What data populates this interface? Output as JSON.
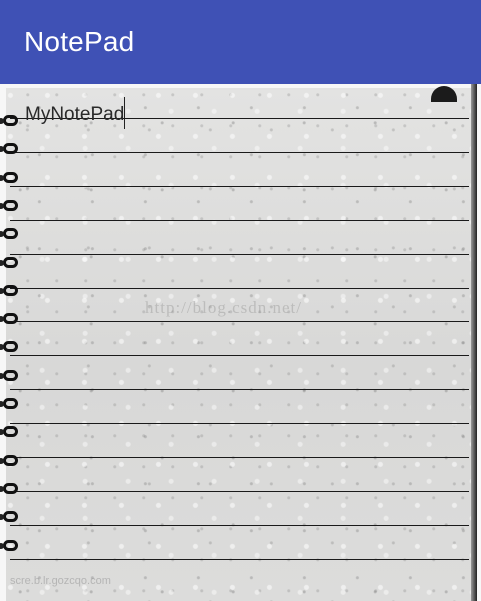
{
  "app_bar": {
    "title": "NotePad",
    "color": "#3f51b5"
  },
  "editor": {
    "text": "MyNotePad",
    "line_count": 14,
    "ring_count": 16
  },
  "watermark": {
    "text": "http://blog.csdn.net/"
  },
  "footer": {
    "text": "scre.b.lr.gozcqo.com"
  }
}
